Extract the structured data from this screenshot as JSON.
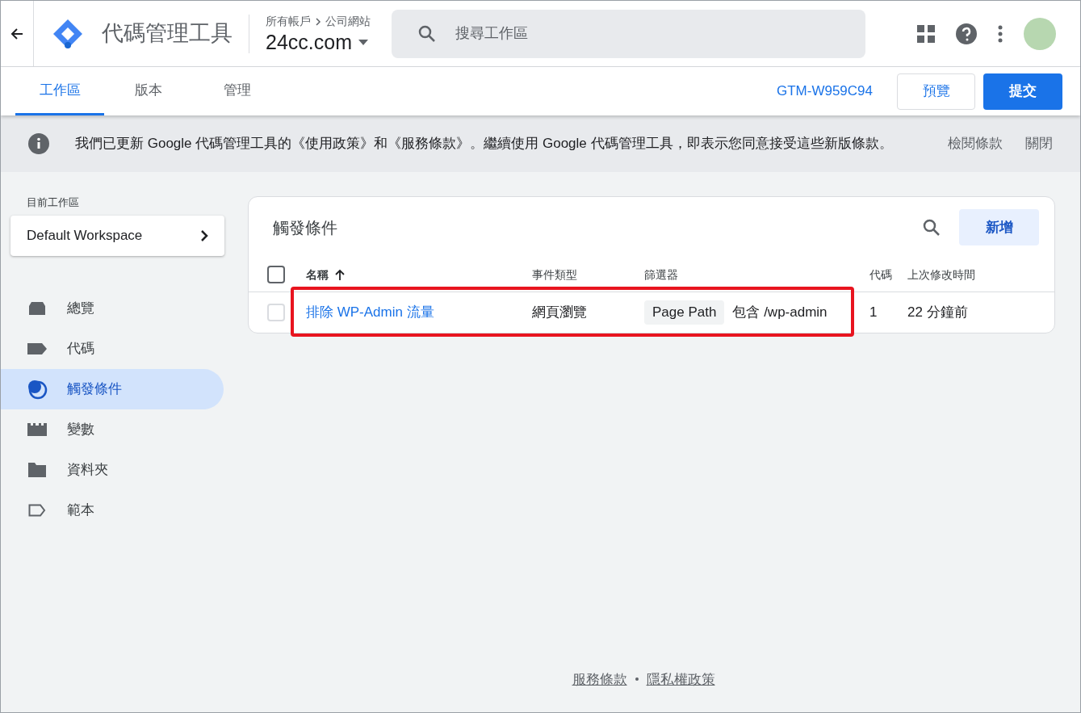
{
  "header": {
    "product": "代碼管理工具",
    "breadcrumb": [
      "所有帳戶",
      "公司網站"
    ],
    "container": "24cc.com",
    "search": {
      "placeholder": "搜尋工作區"
    }
  },
  "tabs": [
    {
      "label": "工作區",
      "selected": true
    },
    {
      "label": "版本",
      "selected": false
    },
    {
      "label": "管理",
      "selected": false
    }
  ],
  "container_id": "GTM-W959C94",
  "preview_button": "預覽",
  "submit_button": "提交",
  "banner": {
    "message": "我們已更新 Google 代碼管理工具的《使用政策》和《服務條款》。繼續使用 Google 代碼管理工具，即表示您同意接受這些新版條款。",
    "actions": [
      "檢閱條款",
      "關閉"
    ]
  },
  "sidebar": {
    "workspace_label": "目前工作區",
    "workspace": "Default Workspace",
    "items": [
      {
        "label": "總覽",
        "kind": "overview",
        "selected": false
      },
      {
        "label": "代碼",
        "kind": "tags",
        "selected": false
      },
      {
        "label": "觸發條件",
        "kind": "triggers",
        "selected": true
      },
      {
        "label": "變數",
        "kind": "variables",
        "selected": false
      },
      {
        "label": "資料夾",
        "kind": "folders",
        "selected": false
      },
      {
        "label": "範本",
        "kind": "templates",
        "selected": false
      }
    ]
  },
  "table": {
    "title": "觸發條件",
    "new_button": "新增",
    "columns": [
      "名稱",
      "事件類型",
      "篩選器",
      "代碼",
      "上次修改時間"
    ],
    "all_checked": false,
    "rows": [
      {
        "checked": false,
        "highlighted": true,
        "name": "排除 WP-Admin 流量",
        "event_type": "網頁瀏覽",
        "filter_variable": "Page Path",
        "filter_rule": "包含 /wp-admin",
        "tags": "1",
        "modified": "22 分鐘前"
      }
    ]
  },
  "footer": [
    "服務條款",
    "隱私權政策"
  ]
}
